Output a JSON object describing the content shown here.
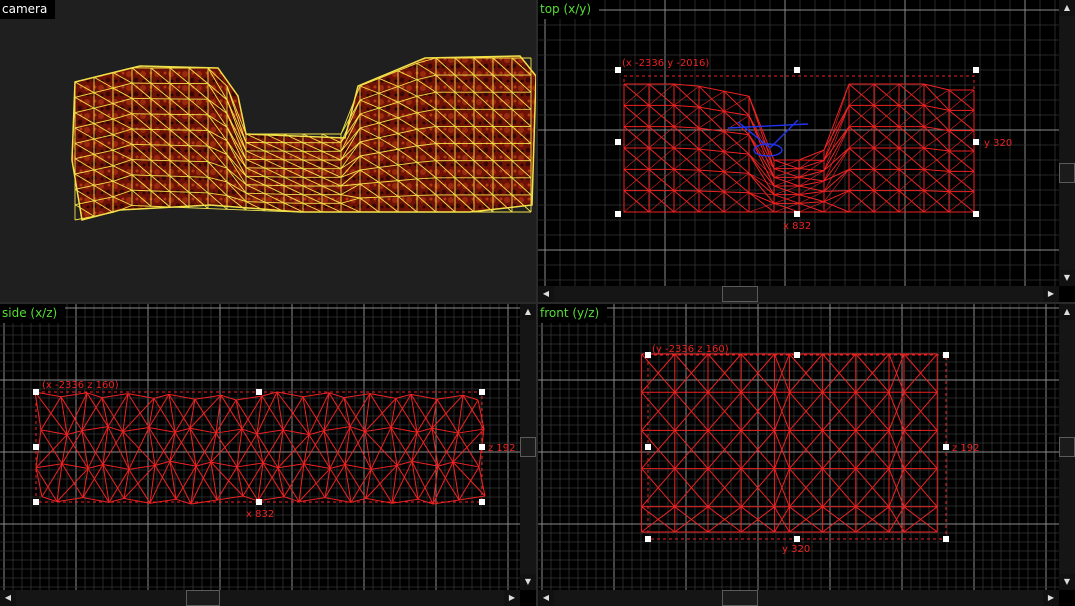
{
  "viewports": {
    "camera": {
      "title": "camera"
    },
    "top": {
      "title": "top (x/y)",
      "corner_label": "(x -2336 y -2016)",
      "right_label": "y 320",
      "bottom_label": "x 832"
    },
    "side": {
      "title": "side (x/z)",
      "corner_label": "(x -2336 z 160)",
      "right_label": "z 192",
      "bottom_label": "x 832"
    },
    "front": {
      "title": "front (y/z)",
      "corner_label": "(y -2336 z 160)",
      "right_label": "z 192",
      "bottom_label": "y 320"
    }
  },
  "colors": {
    "wire_selected": "#ee2222",
    "wire_camera": "#f2e24a",
    "texture": "#7a1408",
    "grid_minor": "#3a3a3a",
    "grid_major": "#8a8a8a",
    "camera_marker": "#2233ee",
    "title_ortho": "#55dd33"
  },
  "icons": [
    "scroll-up-arrow-icon",
    "scroll-down-arrow-icon",
    "scroll-left-arrow-icon",
    "scroll-right-arrow-icon",
    "handle-square-icon",
    "camera-marker-icon"
  ]
}
